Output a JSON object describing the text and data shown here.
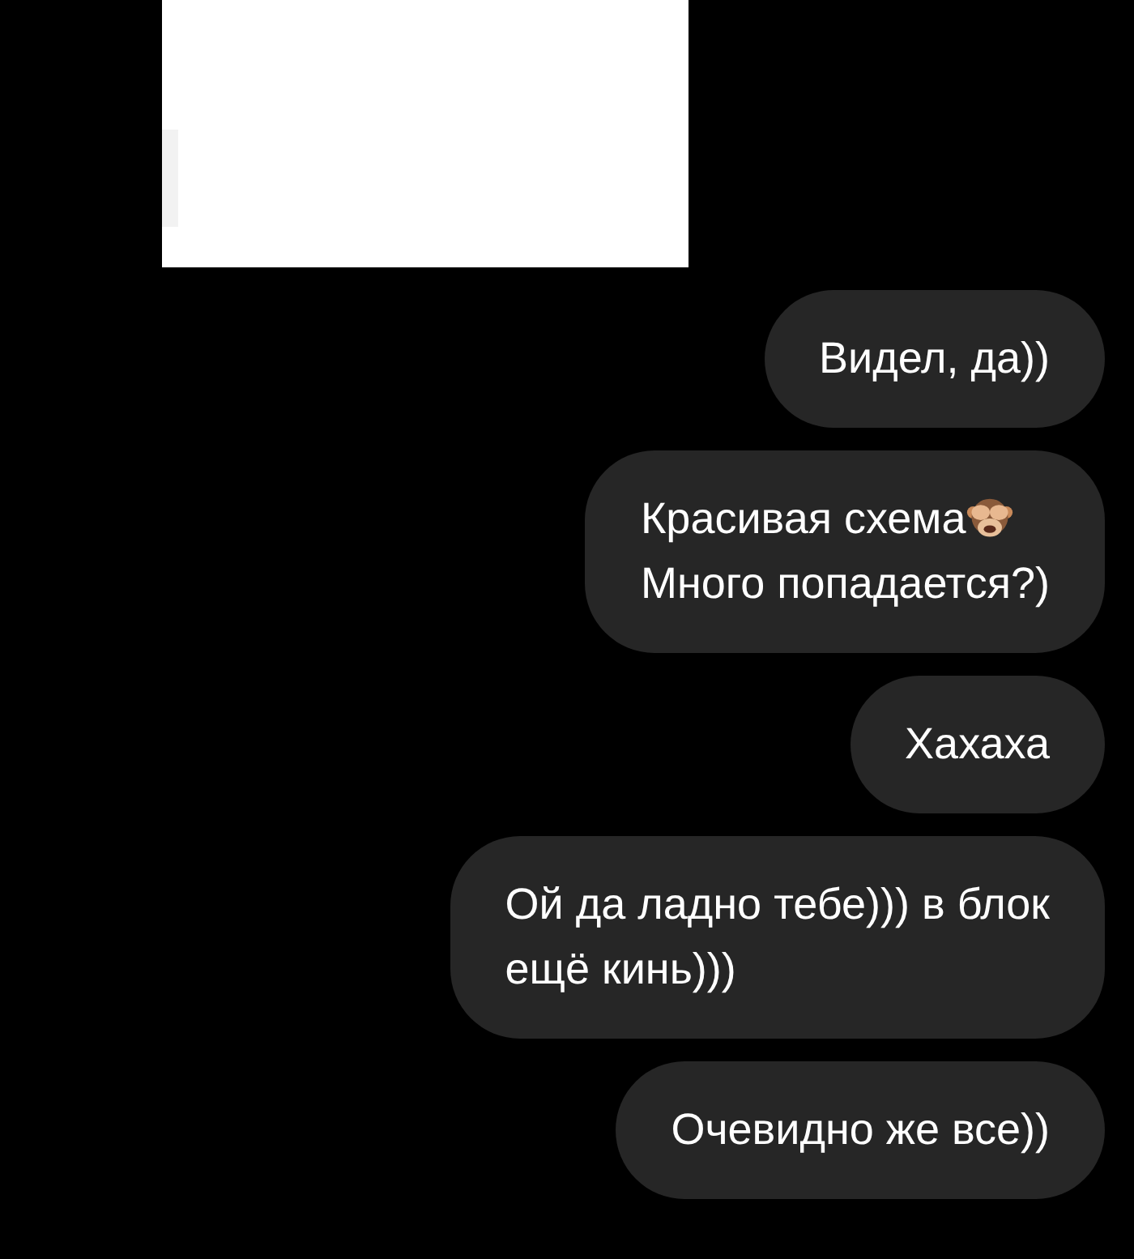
{
  "messages": [
    {
      "parts": [
        {
          "kind": "text",
          "text": "Видел, да))"
        }
      ]
    },
    {
      "parts": [
        {
          "kind": "text",
          "text": "Красивая схема"
        },
        {
          "kind": "emoji"
        },
        {
          "kind": "break"
        },
        {
          "kind": "text",
          "text": "Много попадается?)"
        }
      ]
    },
    {
      "parts": [
        {
          "kind": "text",
          "text": "Хахаха"
        }
      ]
    },
    {
      "parts": [
        {
          "kind": "text",
          "text": "Ой да ладно тебе))) в блок"
        },
        {
          "kind": "break"
        },
        {
          "kind": "text",
          "text": "ещё кинь)))"
        }
      ]
    },
    {
      "parts": [
        {
          "kind": "text",
          "text": "Очевидно же все))"
        }
      ]
    }
  ]
}
